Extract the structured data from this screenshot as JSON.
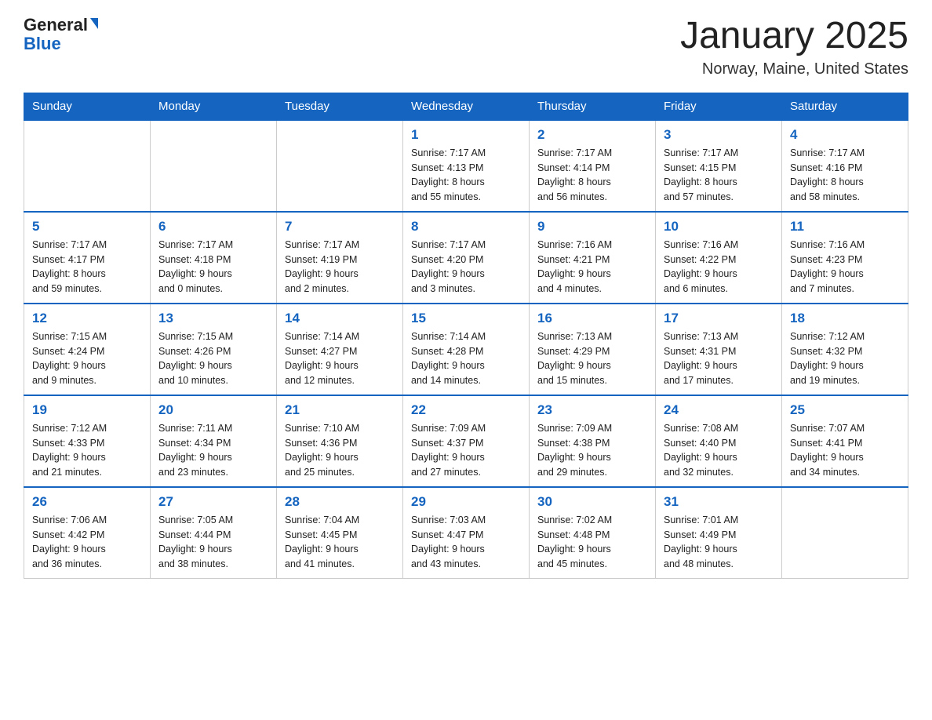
{
  "logo": {
    "general": "General",
    "blue": "Blue"
  },
  "title": "January 2025",
  "location": "Norway, Maine, United States",
  "days_of_week": [
    "Sunday",
    "Monday",
    "Tuesday",
    "Wednesday",
    "Thursday",
    "Friday",
    "Saturday"
  ],
  "weeks": [
    [
      {
        "day": "",
        "info": ""
      },
      {
        "day": "",
        "info": ""
      },
      {
        "day": "",
        "info": ""
      },
      {
        "day": "1",
        "info": "Sunrise: 7:17 AM\nSunset: 4:13 PM\nDaylight: 8 hours\nand 55 minutes."
      },
      {
        "day": "2",
        "info": "Sunrise: 7:17 AM\nSunset: 4:14 PM\nDaylight: 8 hours\nand 56 minutes."
      },
      {
        "day": "3",
        "info": "Sunrise: 7:17 AM\nSunset: 4:15 PM\nDaylight: 8 hours\nand 57 minutes."
      },
      {
        "day": "4",
        "info": "Sunrise: 7:17 AM\nSunset: 4:16 PM\nDaylight: 8 hours\nand 58 minutes."
      }
    ],
    [
      {
        "day": "5",
        "info": "Sunrise: 7:17 AM\nSunset: 4:17 PM\nDaylight: 8 hours\nand 59 minutes."
      },
      {
        "day": "6",
        "info": "Sunrise: 7:17 AM\nSunset: 4:18 PM\nDaylight: 9 hours\nand 0 minutes."
      },
      {
        "day": "7",
        "info": "Sunrise: 7:17 AM\nSunset: 4:19 PM\nDaylight: 9 hours\nand 2 minutes."
      },
      {
        "day": "8",
        "info": "Sunrise: 7:17 AM\nSunset: 4:20 PM\nDaylight: 9 hours\nand 3 minutes."
      },
      {
        "day": "9",
        "info": "Sunrise: 7:16 AM\nSunset: 4:21 PM\nDaylight: 9 hours\nand 4 minutes."
      },
      {
        "day": "10",
        "info": "Sunrise: 7:16 AM\nSunset: 4:22 PM\nDaylight: 9 hours\nand 6 minutes."
      },
      {
        "day": "11",
        "info": "Sunrise: 7:16 AM\nSunset: 4:23 PM\nDaylight: 9 hours\nand 7 minutes."
      }
    ],
    [
      {
        "day": "12",
        "info": "Sunrise: 7:15 AM\nSunset: 4:24 PM\nDaylight: 9 hours\nand 9 minutes."
      },
      {
        "day": "13",
        "info": "Sunrise: 7:15 AM\nSunset: 4:26 PM\nDaylight: 9 hours\nand 10 minutes."
      },
      {
        "day": "14",
        "info": "Sunrise: 7:14 AM\nSunset: 4:27 PM\nDaylight: 9 hours\nand 12 minutes."
      },
      {
        "day": "15",
        "info": "Sunrise: 7:14 AM\nSunset: 4:28 PM\nDaylight: 9 hours\nand 14 minutes."
      },
      {
        "day": "16",
        "info": "Sunrise: 7:13 AM\nSunset: 4:29 PM\nDaylight: 9 hours\nand 15 minutes."
      },
      {
        "day": "17",
        "info": "Sunrise: 7:13 AM\nSunset: 4:31 PM\nDaylight: 9 hours\nand 17 minutes."
      },
      {
        "day": "18",
        "info": "Sunrise: 7:12 AM\nSunset: 4:32 PM\nDaylight: 9 hours\nand 19 minutes."
      }
    ],
    [
      {
        "day": "19",
        "info": "Sunrise: 7:12 AM\nSunset: 4:33 PM\nDaylight: 9 hours\nand 21 minutes."
      },
      {
        "day": "20",
        "info": "Sunrise: 7:11 AM\nSunset: 4:34 PM\nDaylight: 9 hours\nand 23 minutes."
      },
      {
        "day": "21",
        "info": "Sunrise: 7:10 AM\nSunset: 4:36 PM\nDaylight: 9 hours\nand 25 minutes."
      },
      {
        "day": "22",
        "info": "Sunrise: 7:09 AM\nSunset: 4:37 PM\nDaylight: 9 hours\nand 27 minutes."
      },
      {
        "day": "23",
        "info": "Sunrise: 7:09 AM\nSunset: 4:38 PM\nDaylight: 9 hours\nand 29 minutes."
      },
      {
        "day": "24",
        "info": "Sunrise: 7:08 AM\nSunset: 4:40 PM\nDaylight: 9 hours\nand 32 minutes."
      },
      {
        "day": "25",
        "info": "Sunrise: 7:07 AM\nSunset: 4:41 PM\nDaylight: 9 hours\nand 34 minutes."
      }
    ],
    [
      {
        "day": "26",
        "info": "Sunrise: 7:06 AM\nSunset: 4:42 PM\nDaylight: 9 hours\nand 36 minutes."
      },
      {
        "day": "27",
        "info": "Sunrise: 7:05 AM\nSunset: 4:44 PM\nDaylight: 9 hours\nand 38 minutes."
      },
      {
        "day": "28",
        "info": "Sunrise: 7:04 AM\nSunset: 4:45 PM\nDaylight: 9 hours\nand 41 minutes."
      },
      {
        "day": "29",
        "info": "Sunrise: 7:03 AM\nSunset: 4:47 PM\nDaylight: 9 hours\nand 43 minutes."
      },
      {
        "day": "30",
        "info": "Sunrise: 7:02 AM\nSunset: 4:48 PM\nDaylight: 9 hours\nand 45 minutes."
      },
      {
        "day": "31",
        "info": "Sunrise: 7:01 AM\nSunset: 4:49 PM\nDaylight: 9 hours\nand 48 minutes."
      },
      {
        "day": "",
        "info": ""
      }
    ]
  ],
  "colors": {
    "header_bg": "#1565c0",
    "header_text": "#ffffff",
    "day_number": "#1565c0",
    "border": "#cccccc"
  }
}
